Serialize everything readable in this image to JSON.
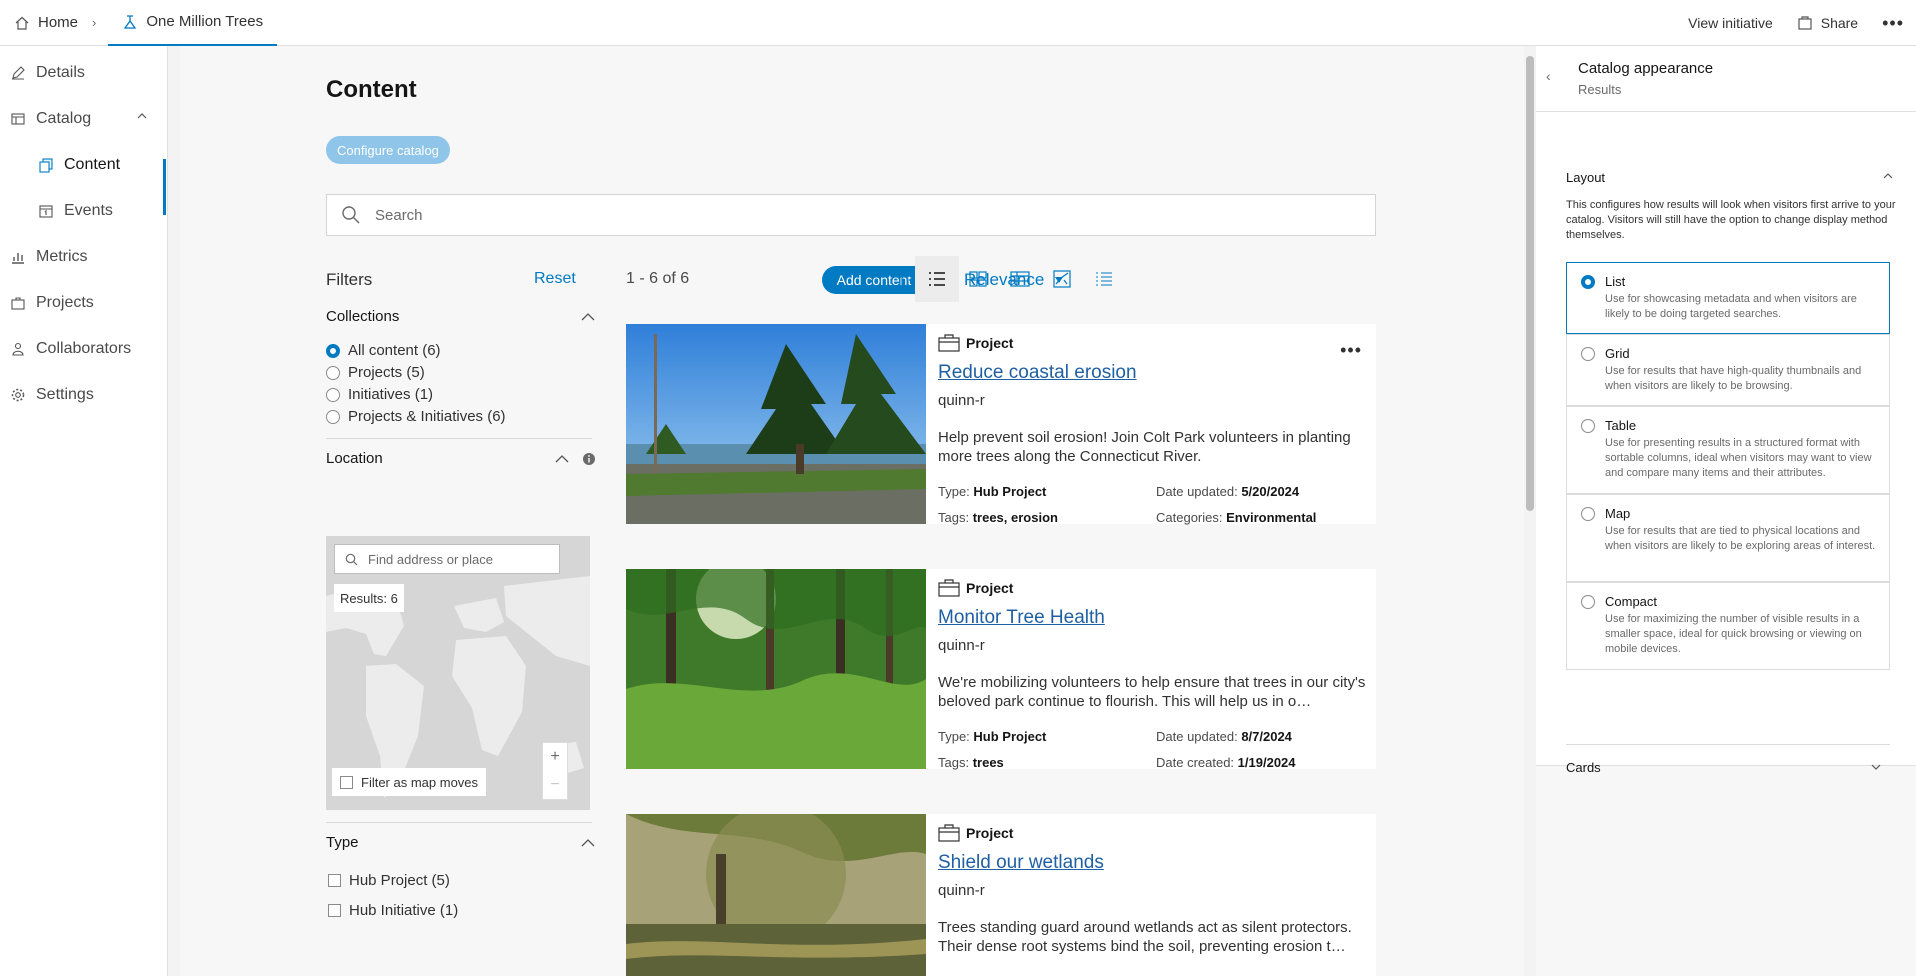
{
  "header": {
    "home_label": "Home",
    "current_label": "One Million Trees",
    "view_initiative": "View initiative",
    "share": "Share"
  },
  "nav": {
    "items": [
      {
        "label": "Details",
        "icon": "pencil-icon"
      },
      {
        "label": "Catalog",
        "icon": "catalog-icon"
      },
      {
        "label": "Content",
        "icon": "content-icon"
      },
      {
        "label": "Events",
        "icon": "calendar-icon"
      },
      {
        "label": "Metrics",
        "icon": "chart-icon"
      },
      {
        "label": "Projects",
        "icon": "briefcase-icon"
      },
      {
        "label": "Collaborators",
        "icon": "people-icon"
      },
      {
        "label": "Settings",
        "icon": "gear-icon"
      }
    ]
  },
  "main": {
    "title": "Content",
    "configure_label": "Configure catalog",
    "search_placeholder": "Search",
    "filters_title": "Filters",
    "reset_label": "Reset",
    "collections_title": "Collections",
    "collections": [
      {
        "label": "All content (6)",
        "selected": true
      },
      {
        "label": "Projects (5)",
        "selected": false
      },
      {
        "label": "Initiatives (1)",
        "selected": false
      },
      {
        "label": "Projects & Initiatives (6)",
        "selected": false
      }
    ],
    "location_title": "Location",
    "map_search_placeholder": "Find address or place",
    "map_results": "Results: 6",
    "filter_as_map_moves": "Filter as map moves",
    "type_title": "Type",
    "types": [
      {
        "label": "Hub Project (5)"
      },
      {
        "label": "Hub Initiative (1)"
      }
    ],
    "result_count": "1 - 6 of 6",
    "add_content_label": "Add content",
    "sort_label": "Relevance",
    "results": [
      {
        "type": "Project",
        "title": "Reduce coastal erosion",
        "owner": "quinn-r",
        "description": "Help prevent soil erosion! Join Colt Park volunteers in planting more trees along the Connecticut River.",
        "type_label": "Type:",
        "type_value": "Hub Project",
        "date_label": "Date updated:",
        "date_value": "5/20/2024",
        "tags_label": "Tags:",
        "tags_value": "trees, erosion",
        "extra_label": "Categories:",
        "extra_value": "Environmental"
      },
      {
        "type": "Project",
        "title": "Monitor Tree Health",
        "owner": "quinn-r",
        "description": "We're mobilizing volunteers to help ensure that trees in our city's beloved park continue to flourish. This will help us in o…",
        "type_label": "Type:",
        "type_value": "Hub Project",
        "date_label": "Date updated:",
        "date_value": "8/7/2024",
        "tags_label": "Tags:",
        "tags_value": "trees",
        "extra_label": "Date created:",
        "extra_value": "1/19/2024"
      },
      {
        "type": "Project",
        "title": "Shield our wetlands",
        "owner": "quinn-r",
        "description": "Trees standing guard around wetlands act as silent protectors. Their dense root systems bind the soil, preventing erosion t…"
      }
    ]
  },
  "panel": {
    "title": "Catalog appearance",
    "subtitle": "Results",
    "layout_title": "Layout",
    "layout_desc": "This configures how results will look when visitors first arrive to your catalog. Visitors will still have the option to change display method themselves.",
    "options": [
      {
        "label": "List",
        "desc": "Use for showcasing metadata and when visitors are likely to be doing targeted searches.",
        "selected": true
      },
      {
        "label": "Grid",
        "desc": "Use for results that have high-quality thumbnails and when visitors are likely to be browsing.",
        "selected": false
      },
      {
        "label": "Table",
        "desc": "Use for presenting results in a structured format with sortable columns, ideal when visitors may want to view and compare many items and their attributes.",
        "selected": false
      },
      {
        "label": "Map",
        "desc": "Use for results that are tied to physical locations and when visitors are likely to be exploring areas of interest.",
        "selected": false
      },
      {
        "label": "Compact",
        "desc": "Use for maximizing the number of visible results in a smaller space, ideal for quick browsing or viewing on mobile devices.",
        "selected": false
      }
    ],
    "cards_title": "Cards"
  },
  "colors": {
    "accent": "#007ac2",
    "link": "#1f5fa3"
  }
}
